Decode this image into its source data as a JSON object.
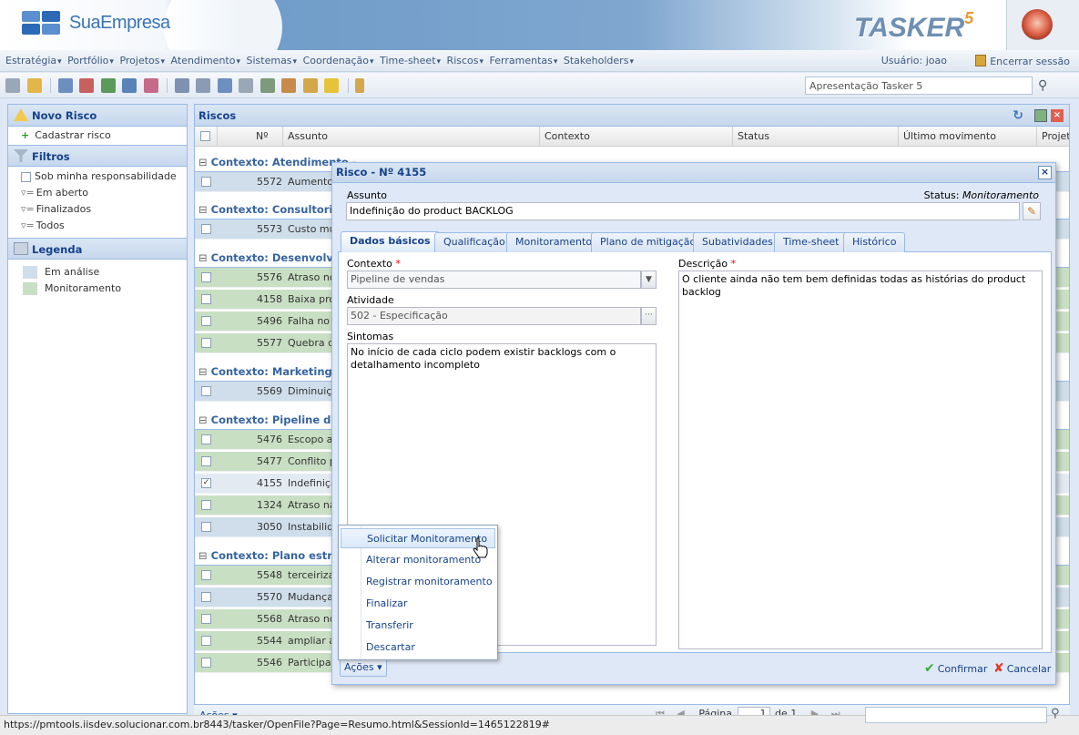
{
  "header": {
    "company": "SuaEmpresa",
    "product": "TASKER",
    "version": "5"
  },
  "menu": [
    "Estratégia",
    "Portfólio",
    "Projetos",
    "Atendimento",
    "Sistemas",
    "Coordenação",
    "Time-sheet",
    "Riscos",
    "Ferramentas",
    "Stakeholders"
  ],
  "user_label": "Usuário: joao",
  "logout_label": "Encerrar sessão",
  "search_value": "Apresentação Tasker 5",
  "left": {
    "new_risk": {
      "title": "Novo Risco",
      "items": [
        "Cadastrar risco"
      ]
    },
    "filters": {
      "title": "Filtros",
      "items": [
        "Sob minha responsabilidade",
        "Em aberto",
        "Finalizados",
        "Todos"
      ]
    },
    "legend": {
      "title": "Legenda",
      "items": [
        {
          "label": "Em análise",
          "color": "#cfdeea"
        },
        {
          "label": "Monitoramento",
          "color": "#c9dfc4"
        }
      ]
    }
  },
  "grid": {
    "title": "Riscos",
    "columns": [
      "Nº",
      "Assunto",
      "Contexto",
      "Status",
      "Último movimento",
      "Projeto"
    ],
    "groups": [
      {
        "label": "Contexto: Atendimento - ",
        "rows": [
          {
            "n": "5572",
            "a": "Aumento"
          }
        ]
      },
      {
        "label": "Contexto: Consultoria",
        "rows": [
          {
            "n": "5573",
            "a": "Custo mui"
          }
        ]
      },
      {
        "label": "Contexto: Desenvolvim",
        "rows": [
          {
            "n": "5576",
            "a": "Atraso no"
          },
          {
            "n": "4158",
            "a": "Baixa proc"
          },
          {
            "n": "5496",
            "a": "Falha no le"
          },
          {
            "n": "5577",
            "a": "Quebra de"
          }
        ]
      },
      {
        "label": "Contexto: Marketing Co",
        "rows": [
          {
            "n": "5569",
            "a": "Diminuiçã"
          }
        ]
      },
      {
        "label": "Contexto: Pipeline de ve",
        "rows": [
          {
            "n": "5476",
            "a": "Escopo ab"
          },
          {
            "n": "5477",
            "a": "Conflito po"
          },
          {
            "n": "4155",
            "a": "Indefiniçã"
          },
          {
            "n": "1324",
            "a": "Atraso na"
          },
          {
            "n": "3050",
            "a": "Instabilida"
          }
        ]
      },
      {
        "label": "Contexto: Plano estrat",
        "rows": [
          {
            "n": "5548",
            "a": "terceirizar"
          },
          {
            "n": "5570",
            "a": "Mudanças"
          },
          {
            "n": "5568",
            "a": "Atraso no"
          },
          {
            "n": "5544",
            "a": "ampliar a c"
          },
          {
            "n": "5546",
            "a": "Participaç"
          }
        ]
      }
    ],
    "footer": {
      "actions": "Ações",
      "page_label": "Página",
      "page": "1",
      "of": "de 1"
    }
  },
  "dialog": {
    "title": "Risco - Nº 4155",
    "subject_label": "Assunto",
    "status_label": "Status:",
    "status_value": "Monitoramento",
    "subject_value": "Indefinição do product BACKLOG",
    "tabs": [
      "Dados básicos",
      "Qualificação",
      "Monitoramento",
      "Plano de mitigação",
      "Subatividades",
      "Time-sheet",
      "Histórico"
    ],
    "context_label": "Contexto",
    "context_value": "Pipeline de vendas",
    "activity_label": "Atividade",
    "activity_value": "502 - Especificação",
    "symptoms_label": "Sintomas",
    "symptoms_value": "No início de cada ciclo podem existir backlogs com o detalhamento incompleto",
    "description_label": "Descrição",
    "description_value": "O cliente ainda não tem bem definidas todas as histórias do product backlog",
    "actions_label": "Ações",
    "confirm_label": "Confirmar",
    "cancel_label": "Cancelar"
  },
  "actions_menu": [
    "Solicitar Monitoramento",
    "Alterar monitoramento",
    "Registrar monitoramento",
    "Finalizar",
    "Transferir",
    "Descartar"
  ],
  "statusbar": "https://pmtools.iisdev.solucionar.com.br8443/tasker/OpenFile?Page=Resumo.html&SessionId=1465122819#"
}
